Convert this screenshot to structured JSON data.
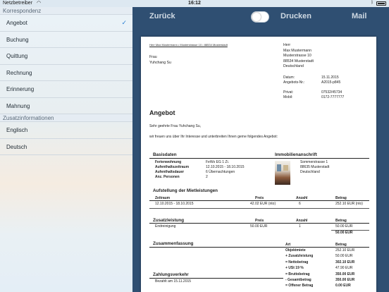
{
  "status_bar": {
    "carrier": "Netzbetreiber",
    "wifi_icon": "wifi-icon",
    "time": "16:12",
    "bluetooth_icon": "bluetooth-icon",
    "battery_icon": "battery-icon"
  },
  "sidebar": {
    "section1": "Korrespondenz",
    "items1": [
      {
        "label": "Angebot",
        "selected": true
      },
      {
        "label": "Buchung"
      },
      {
        "label": "Quittung"
      },
      {
        "label": "Rechnung"
      },
      {
        "label": "Erinnerung"
      },
      {
        "label": "Mahnung"
      }
    ],
    "section2": "Zusatzinformationen",
    "items2": [
      {
        "label": "Englisch"
      },
      {
        "label": "Deutsch"
      }
    ]
  },
  "toolbar": {
    "back": "Zurück",
    "print": "Drucken",
    "mail": "Mail"
  },
  "doc": {
    "sender_line": "Herr Max Mustermann • Musterstrasse 10 • 88534 Musterstadt",
    "recipient": [
      "Frau",
      "Yuhchang Su"
    ],
    "sender_block": [
      "Herr",
      "Max Mustermann",
      "Musterstrasse 10",
      "88534 Musterstadt",
      "Deutschland"
    ],
    "meta": [
      {
        "k": "Datum:",
        "v": "15.11.2015"
      },
      {
        "k": "Angebots-Nr.:",
        "v": "A2015-p845"
      }
    ],
    "contact": [
      {
        "k": "Privat:",
        "v": "07532/45734"
      },
      {
        "k": "Mobil:",
        "v": "0172-7777777"
      }
    ],
    "title": "Angebot",
    "greeting": "Sehr geehrte Frau Yuhchang Su,",
    "intro": "wir freuen uns über Ihr Interesse und unterbreiten Ihnen gerne folgendes Angebot:",
    "basisdaten": {
      "heading": "Basisdaten",
      "rows": [
        {
          "k": "Ferienwohnung",
          "v": "FeWo EG 1 Zi."
        },
        {
          "k": "Aufenthaltszeitraum",
          "v": "12.10.2015 - 18.10.2015"
        },
        {
          "k": "Aufenthaltsdauer",
          "v": "6 Übernachtungen"
        },
        {
          "k": "Anz. Personen",
          "v": "2"
        }
      ]
    },
    "immobilie": {
      "heading": "Immobilienanschrift",
      "lines": [
        "Sommerstrasse 1",
        "88635 Musterstadt",
        "Deutschland"
      ]
    },
    "miet": {
      "heading": "Aufstellung der Mietleistungen",
      "cols": [
        "Zeitraum",
        "Preis",
        "Anzahl",
        "Betrag"
      ],
      "row": [
        "12.10.2015 - 18.10.2015",
        "42.02 EUR (nto)",
        "6",
        "252.10 EUR (nto)"
      ]
    },
    "zusatz": {
      "heading": "Zusatzleistung",
      "cols": [
        "",
        "Preis",
        "Anzahl",
        "Betrag"
      ],
      "row": [
        "Endreinigung",
        "50.00 EUR",
        "1",
        "50.00 EUR"
      ],
      "total": "50.00 EUR"
    },
    "summary": {
      "heading": "Zusammenfassung",
      "cols": [
        "Art",
        "Betrag"
      ],
      "rows": [
        {
          "k": "Objektmiete",
          "v": "252.10 EUR",
          "bold": true
        },
        {
          "k": "+ Zusatzleistung",
          "v": "50.00 EUR",
          "bold": true
        },
        {
          "k": "= Nettobetrag",
          "v": "302.10 EUR",
          "bold": true
        },
        {
          "k": "+ USt 19 %",
          "v": "47.90 EUR",
          "bold": true
        },
        {
          "k": "= Bruttobetrag",
          "v": "350.00 EUR",
          "bold": true
        },
        {
          "k": "- Gesamtbetrag",
          "v": "350.00 EUR",
          "bold": true
        },
        {
          "k": "= Offener Betrag",
          "v": "0.00 EUR",
          "bold": true
        }
      ]
    },
    "zahlung": {
      "heading": "Zahlungsverkehr",
      "row": "Bezahlt am 15.11.2015"
    }
  }
}
